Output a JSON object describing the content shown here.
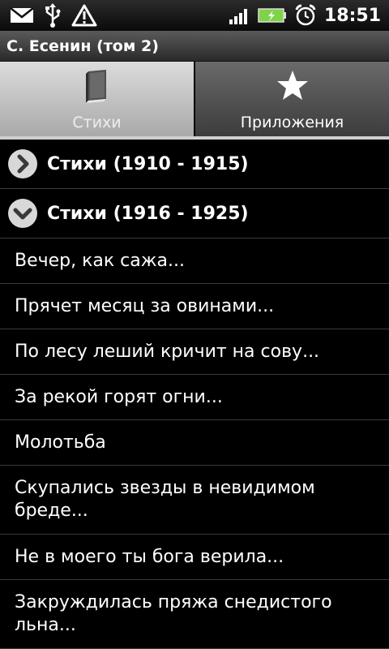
{
  "status_bar": {
    "time": "18:51",
    "icons": [
      "email-icon",
      "usb-icon",
      "warning-icon",
      "signal-icon",
      "battery-charging-icon",
      "alarm-icon"
    ]
  },
  "title_bar": {
    "title": "С. Есенин (том 2)"
  },
  "tabs": [
    {
      "label": "Стихи",
      "icon": "book-icon",
      "active": true
    },
    {
      "label": "Приложения",
      "icon": "star-icon",
      "active": false
    }
  ],
  "groups": [
    {
      "label": "Стихи (1910 - 1915)",
      "icon": "chevron-right-icon",
      "expanded": false
    },
    {
      "label": "Стихи (1916 - 1925)",
      "icon": "chevron-down-icon",
      "expanded": true
    }
  ],
  "items": [
    "Вечер, как сажа...",
    "Прячет месяц за овинами...",
    "По лесу леший кричит на сову...",
    "За рекой горят огни...",
    "Молотьба",
    "Скупались звезды в невидимом бреде...",
    "Не в моего ты бога верила...",
    "Закруждилась пряжа снедистого льна..."
  ],
  "colors": {
    "battery_green": "#7ed348",
    "tab_active": "#c4c4c4",
    "tab_inactive": "#555555",
    "divider": "#3a3a3a"
  }
}
